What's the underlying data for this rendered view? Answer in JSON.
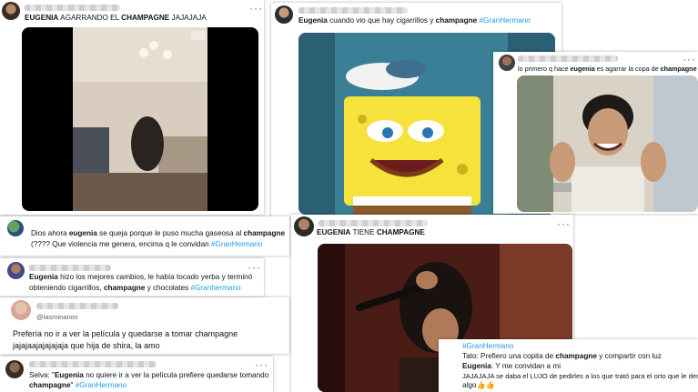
{
  "tweets": [
    {
      "author": "EUGENIA",
      "t1": " AGARRANDO EL ",
      "kw": "CHAMPAGNE",
      "t2": " JAJAJAJA",
      "menu": "···"
    },
    {
      "author": "Eugenia",
      "t1": " cuando vio que hay cigarrillos y ",
      "kw": "champagne",
      "tag": "#GranHermano",
      "menu": "···"
    },
    {
      "t1": "lo primero q hace ",
      "author": "eugenia",
      "t2": " es agarrar la copa de ",
      "kw": "champagne",
      "menu": "···"
    },
    {
      "t1": "Dios ahora ",
      "author": "eugenia",
      "t2": " se queja porque le puso mucha gaseosa al ",
      "kw": "champagne",
      "line2": "(???? Que violencia me genera, encima q le convidan ",
      "tag": "#GranHermano"
    },
    {
      "author": "Eugenia",
      "t1": " hizo los mejores cambios, le había tocado yerba y terminó",
      "line2a": "obteniendo cigarrillos, ",
      "kw": "champagne",
      "line2b": " y chocolates ",
      "tag": "#Granhermano",
      "menu": "···"
    },
    {
      "handle": "@lasminanov",
      "line1": "Prefería no ir a ver la película y quedarse a tomar champagne",
      "line2": "jajajaajajajajaja que hija de shira, la amo"
    },
    {
      "t1": "Selva: \"",
      "author": "Eugenia",
      "t2": " no quiere ir a ver la película prefiere quedarse tomando",
      "kw": "champagne",
      "t3": "\" ",
      "tag": "#GranHermano",
      "menu": "···"
    },
    {
      "author": "EUGENIA",
      "t1": " TIENE ",
      "kw": "CHAMPAGNE",
      "menu": "···"
    },
    {
      "tag": "#GranHermano",
      "l2a": "Tato: Prefiero una copita de ",
      "kw": "champagne",
      "l2b": " y compartir con luz",
      "l3author": "Eugenia",
      "l3": ": Y me convidan a mi",
      "l4": "JAJAJAJA se daba el LUJO de pedirles a los que trató para el orto que le den",
      "l5": "algo",
      "emoji": "👍👍"
    }
  ],
  "colors": {
    "link": "#1d9bf0",
    "text": "#0f1419",
    "muted": "#536471"
  }
}
